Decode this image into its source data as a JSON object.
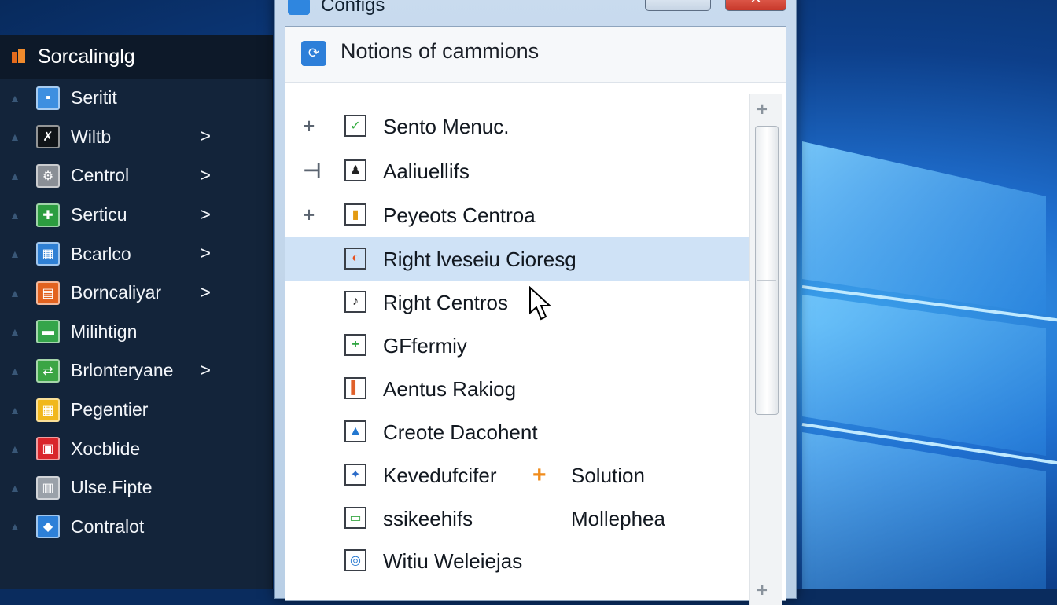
{
  "window": {
    "title": "Configs",
    "minimize_label": "",
    "close_label": "✕"
  },
  "dialog": {
    "heading": "Notions of cammions",
    "items": [
      {
        "expander": "+",
        "label": "Sento Menuc.",
        "icon": "checkbox-checked-icon",
        "icon_glyph": "✓",
        "icon_color": "#2eaa3a"
      },
      {
        "expander": "⊣",
        "label": "Aaliuellifs",
        "icon": "user-icon",
        "icon_glyph": "♟",
        "icon_color": "#222222"
      },
      {
        "expander": "+",
        "label": "Peyeots Centroa",
        "icon": "yellow-doc-icon",
        "icon_glyph": "▮",
        "icon_color": "#e39a12"
      },
      {
        "expander": "",
        "label": "Right lveseiu Cioresg",
        "icon": "disc-icon",
        "icon_glyph": "◐",
        "icon_color": "#e8501e",
        "selected": true
      },
      {
        "expander": "",
        "label": "Right Centros",
        "icon": "edit-icon",
        "icon_glyph": "♪",
        "icon_color": "#222222"
      },
      {
        "expander": "",
        "label": "GFfermiy",
        "icon": "plus-icon",
        "icon_glyph": "+",
        "icon_color": "#2fa440"
      },
      {
        "expander": "",
        "label": "Aentus Rakiog",
        "icon": "orange-box-icon",
        "icon_glyph": "▌",
        "icon_color": "#e0602a"
      },
      {
        "expander": "",
        "label": "Creote Dacohent",
        "icon": "triangle-icon",
        "icon_glyph": "▲",
        "icon_color": "#2377d0"
      },
      {
        "expander": "",
        "label": "Kevedufcifer",
        "icon": "bird-icon",
        "icon_glyph": "✦",
        "icon_color": "#2a6bc8",
        "extra_icon": "+",
        "extra_label": "Solution"
      },
      {
        "expander": "",
        "label": "ssikeehifs",
        "icon": "chat-icon",
        "icon_glyph": "▭",
        "icon_color": "#3aa845",
        "extra_label": "Mollephea"
      },
      {
        "expander": "",
        "label": "Witiu Weleiejas",
        "icon": "target-icon",
        "icon_glyph": "◎",
        "icon_color": "#2377d0"
      }
    ]
  },
  "sidebar": {
    "title": "Sorcalinglg",
    "items": [
      {
        "label": "Seritit",
        "icon": "document-icon",
        "icon_color": "#3d8fe0",
        "glyph": "▪",
        "chevron": ""
      },
      {
        "label": "Wiltb",
        "icon": "person-icon",
        "icon_color": "#101418",
        "glyph": "✗",
        "chevron": ">"
      },
      {
        "label": "Centrol",
        "icon": "control-icon",
        "icon_color": "#8a8f96",
        "glyph": "⚙",
        "chevron": ">"
      },
      {
        "label": "Serticu",
        "icon": "network-icon",
        "icon_color": "#2c9d3f",
        "glyph": "✚",
        "chevron": ">"
      },
      {
        "label": "Bcarlco",
        "icon": "grid-icon",
        "icon_color": "#2f80d4",
        "glyph": "▦",
        "chevron": ">"
      },
      {
        "label": "Borncaliyar",
        "icon": "orange-grid-icon",
        "icon_color": "#e2621f",
        "glyph": "▤",
        "chevron": ">"
      },
      {
        "label": "Milihtign",
        "icon": "green-square-icon",
        "icon_color": "#35a54a",
        "glyph": "▬",
        "chevron": ""
      },
      {
        "label": "Brlonteryane",
        "icon": "green-frame-icon",
        "icon_color": "#3ba544",
        "glyph": "⇄",
        "chevron": ">"
      },
      {
        "label": "Pegentier",
        "icon": "yellow-grid-icon",
        "icon_color": "#f1b81c",
        "glyph": "▦",
        "chevron": ""
      },
      {
        "label": "Xocblide",
        "icon": "red-box-icon",
        "icon_color": "#d9262b",
        "glyph": "▣",
        "chevron": ""
      },
      {
        "label": "Ulse.Fipte",
        "icon": "gray-box-icon",
        "icon_color": "#9aa1a9",
        "glyph": "▥",
        "chevron": ""
      },
      {
        "label": "Contralot",
        "icon": "shield-icon",
        "icon_color": "#2d80d8",
        "glyph": "◆",
        "chevron": ""
      }
    ]
  }
}
